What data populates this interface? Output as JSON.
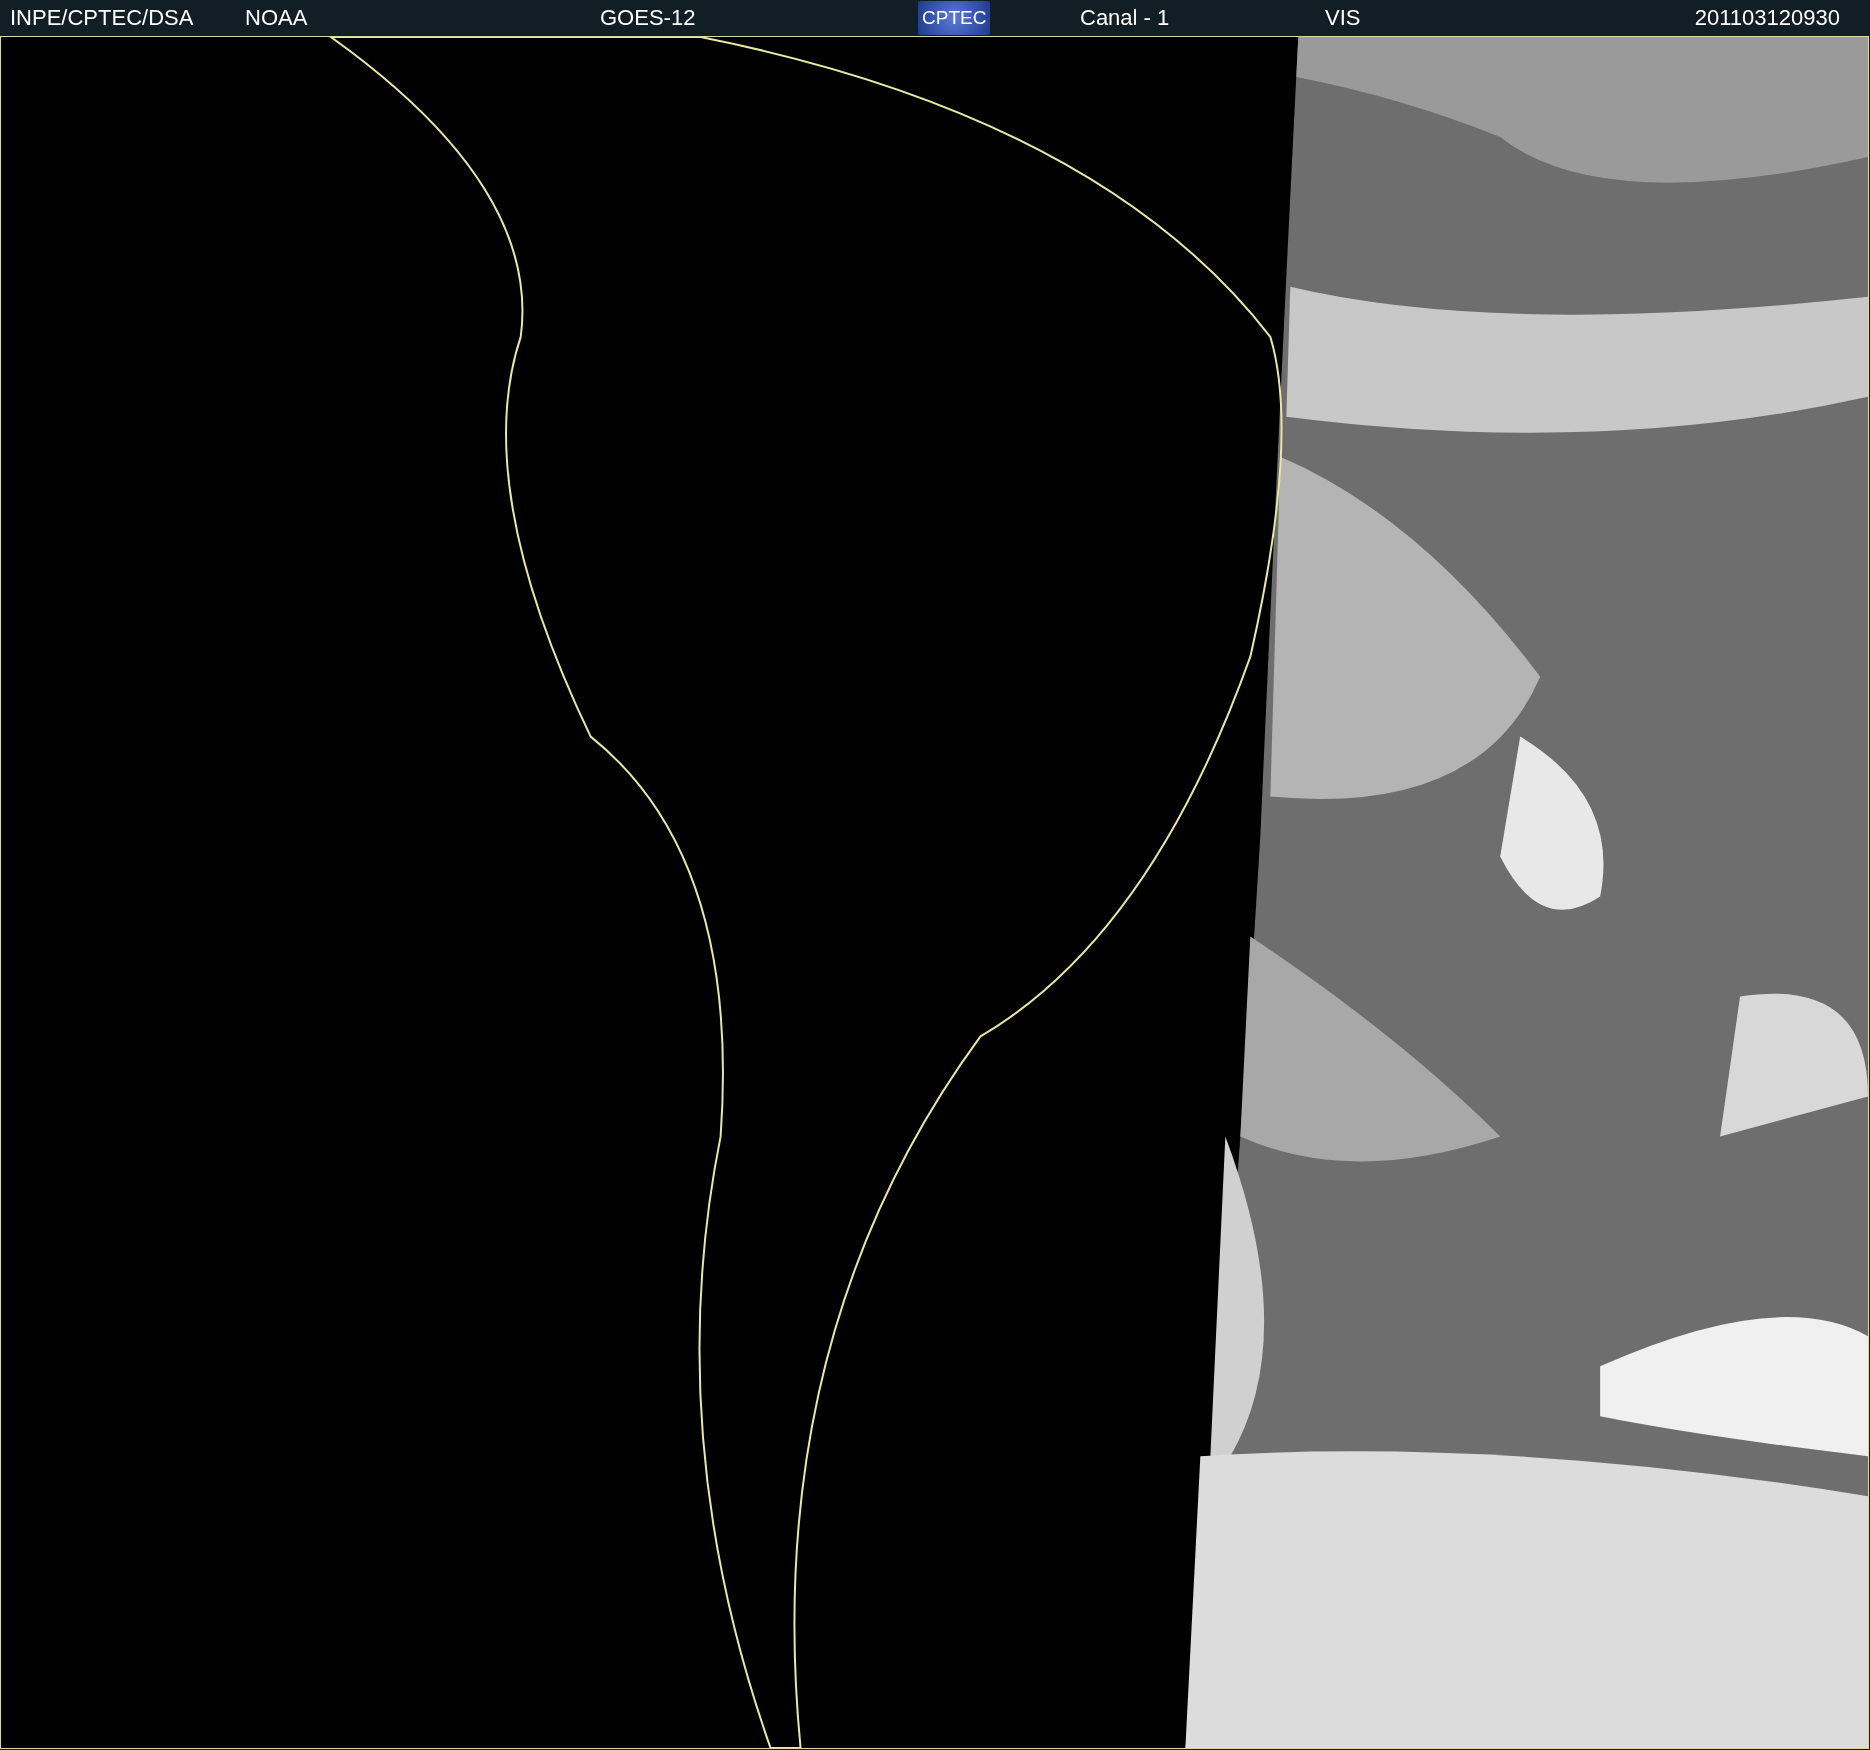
{
  "header": {
    "items": [
      {
        "kind": "text",
        "text": "INPE/CPTEC/DSA"
      },
      {
        "kind": "text",
        "text": "NOAA"
      },
      {
        "kind": "text",
        "text": "GOES-12"
      },
      {
        "kind": "logo",
        "text": "CPTEC"
      },
      {
        "kind": "text",
        "text": "Canal - 1"
      },
      {
        "kind": "text",
        "text": "VIS"
      },
      {
        "kind": "text",
        "text": "201103120930"
      }
    ]
  }
}
